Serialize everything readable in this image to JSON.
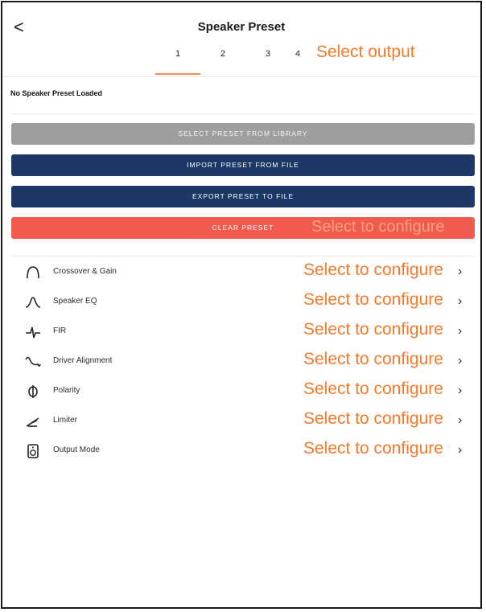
{
  "header": {
    "back_glyph": "<",
    "title": "Speaker Preset"
  },
  "tabs": [
    "1",
    "2",
    "3",
    "4"
  ],
  "output_hint": "Select output",
  "status": "No Speaker Preset Loaded",
  "buttons": {
    "select_library": "SELECT PRESET FROM LIBRARY",
    "import": "IMPORT PRESET FROM FILE",
    "export": "EXPORT PRESET TO FILE",
    "clear": "CLEAR PRESET",
    "clear_overlay": "Select to configure"
  },
  "items": [
    {
      "label": "Crossover & Gain",
      "action": "Select to configure",
      "icon": "crossover-icon"
    },
    {
      "label": "Speaker EQ",
      "action": "Select to configure",
      "icon": "eq-curve-icon"
    },
    {
      "label": "FIR",
      "action": "Select to configure",
      "icon": "fir-icon"
    },
    {
      "label": "Driver Alignment",
      "action": "Select to configure",
      "icon": "driver-alignment-icon"
    },
    {
      "label": "Polarity",
      "action": "Select to configure",
      "icon": "polarity-icon"
    },
    {
      "label": "Limiter",
      "action": "Select to configure",
      "icon": "limiter-icon"
    },
    {
      "label": "Output Mode",
      "action": "Select to configure",
      "icon": "speaker-icon"
    }
  ],
  "colors": {
    "accent_orange": "#f5792b",
    "navy": "#1b3866",
    "clear_red": "#f05a4f",
    "disabled_grey": "#9e9e9e"
  }
}
